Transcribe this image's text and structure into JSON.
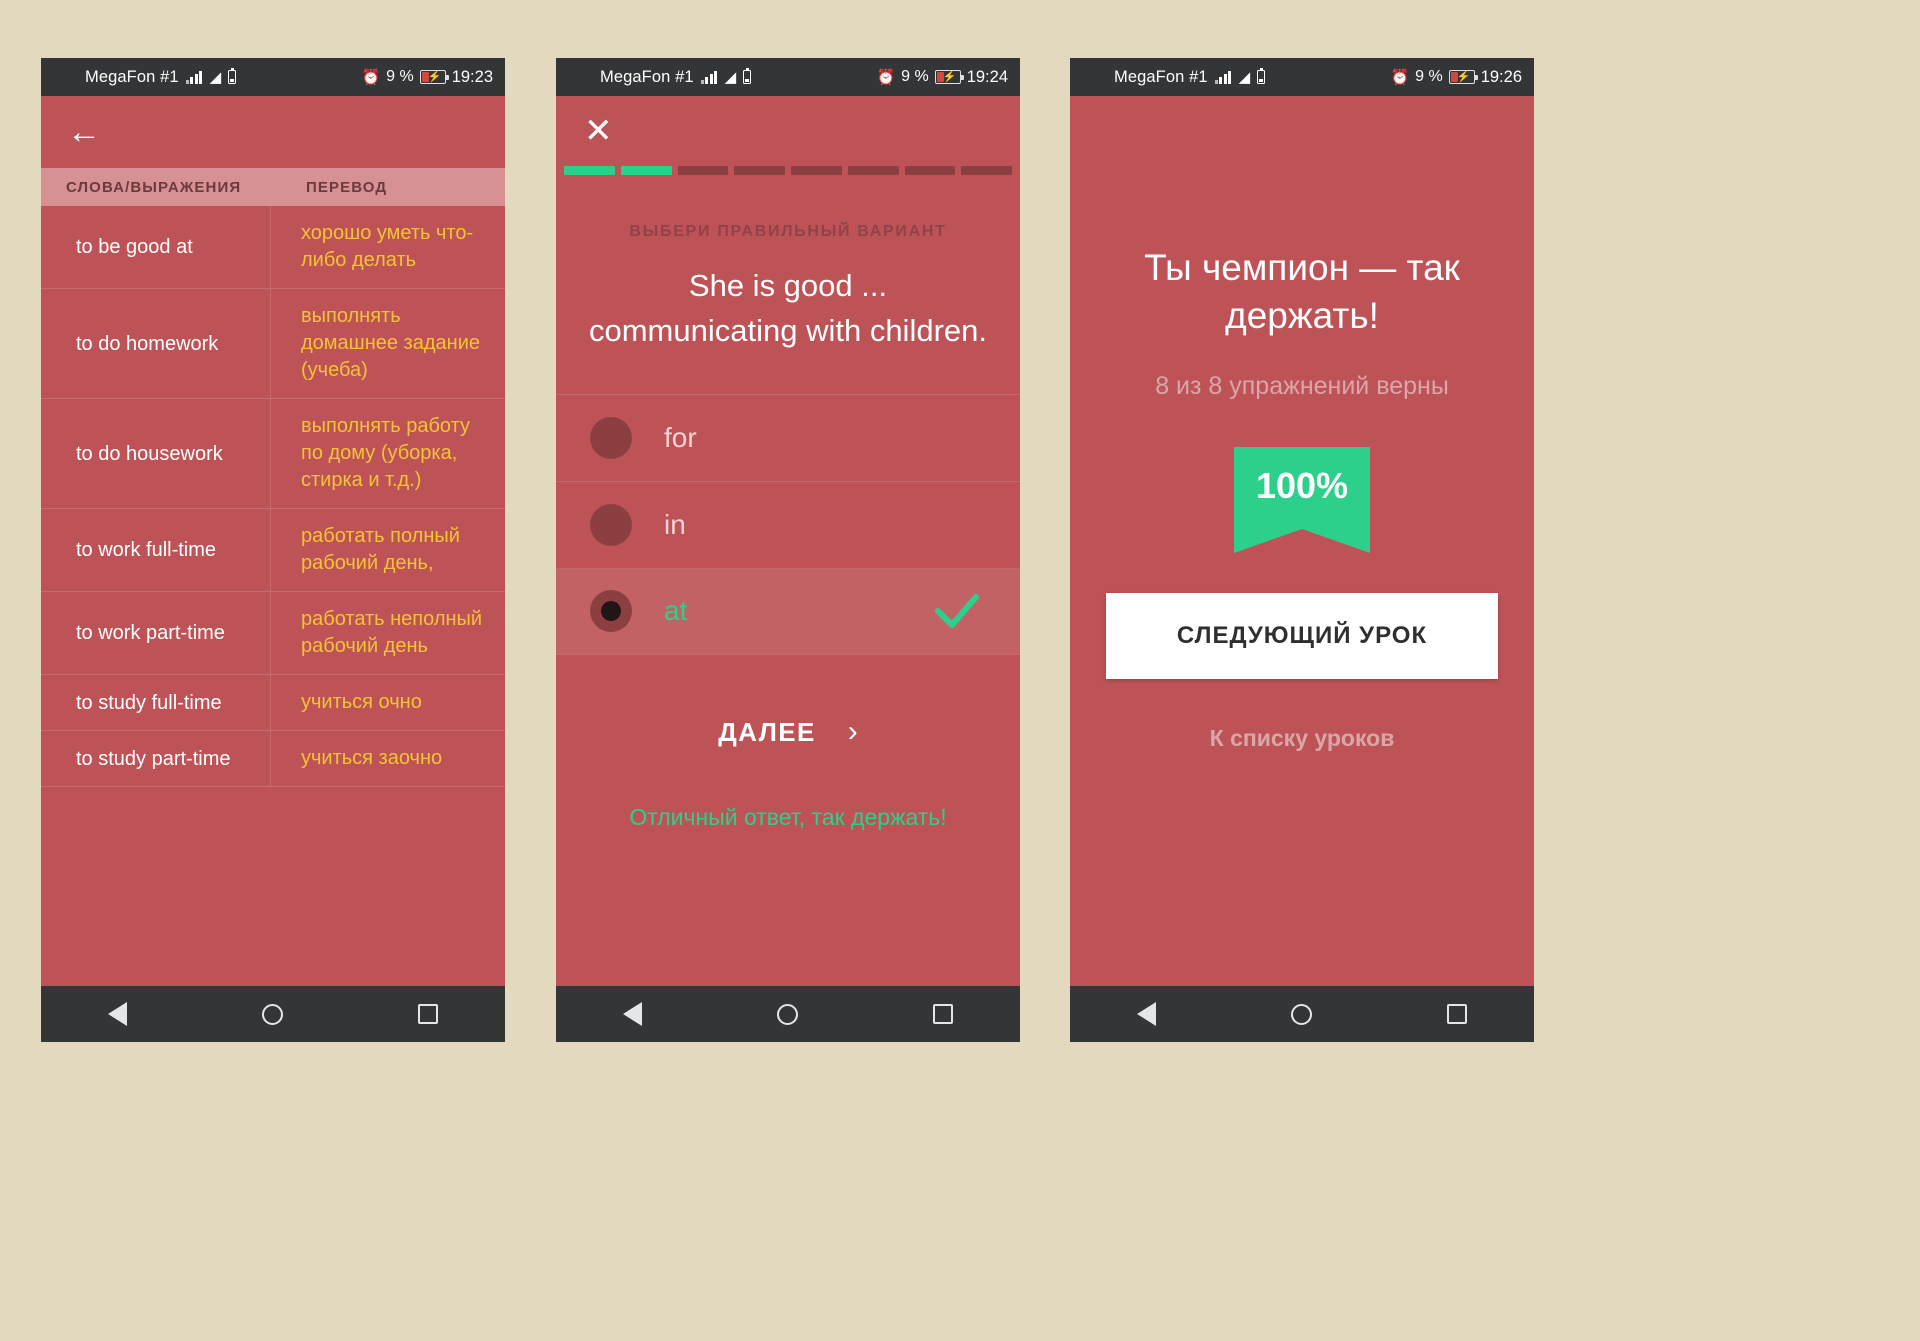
{
  "statusbar": {
    "carrier": "MegaFon #1",
    "battery_percent": "9 %",
    "icons": [
      "signal-icon",
      "wifi-icon",
      "battery-icon",
      "alarm-icon"
    ],
    "time_1": "19:23",
    "time_2": "19:24",
    "time_3": "19:26"
  },
  "colors": {
    "page_background": "#e3d9bf",
    "app_red": "#bd5356",
    "header_pink": "#d79194",
    "translation_yellow": "#f5c335",
    "accent_green": "#2dd08b",
    "status_dark": "#333537"
  },
  "navbar": {
    "back": "back-triangle-icon",
    "home": "home-circle-icon",
    "recents": "recents-square-icon"
  },
  "phone1": {
    "back_icon": "back-arrow-icon",
    "table": {
      "headers": [
        "СЛОВА/ВЫРАЖЕНИЯ",
        "ПЕРЕВОД"
      ],
      "rows": [
        {
          "word": "to be good at",
          "translation": "хорошо уметь что-либо делать"
        },
        {
          "word": "to do homework",
          "translation": "выполнять домашнее задание (учеба)"
        },
        {
          "word": "to do housework",
          "translation": "выполнять работу по дому (уборка, стирка и т.д.)"
        },
        {
          "word": "to work full-time",
          "translation": "работать полный рабочий день,"
        },
        {
          "word": "to work part-time",
          "translation": "работать неполный рабочий день"
        },
        {
          "word": "to study full-time",
          "translation": "учиться очно"
        },
        {
          "word": "to study part-time",
          "translation": "учиться заочно"
        }
      ]
    }
  },
  "phone2": {
    "close_icon": "close-x-icon",
    "progress": {
      "total": 8,
      "completed": 2
    },
    "prompt": "ВЫБЕРИ ПРАВИЛЬНЫЙ ВАРИАНТ",
    "sentence": "She is good ... communicating with children.",
    "options": [
      {
        "label": "for",
        "selected": false,
        "correct": false
      },
      {
        "label": "in",
        "selected": false,
        "correct": false
      },
      {
        "label": "at",
        "selected": true,
        "correct": true
      }
    ],
    "check_icon": "checkmark-icon",
    "next_label": "ДАЛЕЕ",
    "next_icon": "chevron-right-icon",
    "feedback": "Отличный ответ, так держать!"
  },
  "phone3": {
    "title": "Ты чемпион — так держать!",
    "subtitle": "8 из 8 упражнений верны",
    "score_badge": "100%",
    "next_lesson_button": "СЛЕДУЮЩИЙ УРОК",
    "lessons_link": "К списку уроков"
  }
}
